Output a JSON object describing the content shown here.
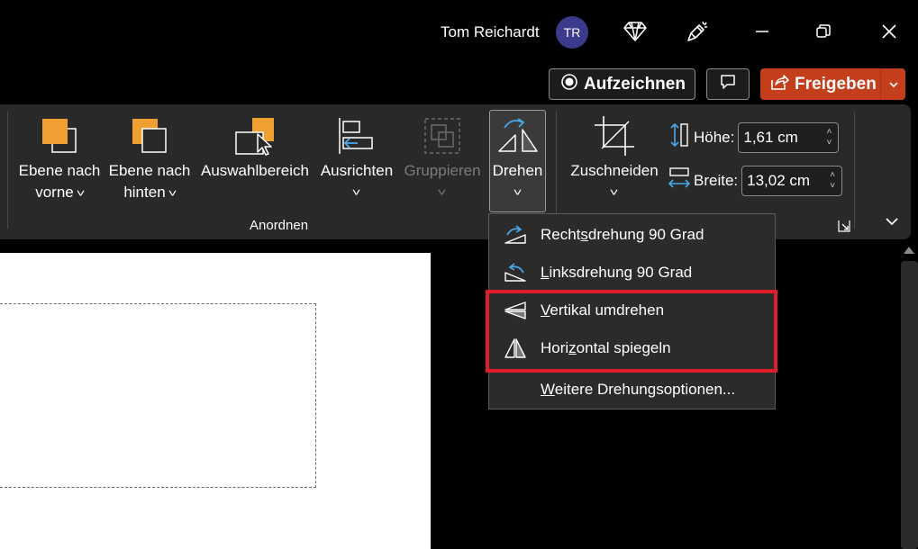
{
  "titlebar": {
    "user_name": "Tom Reichardt",
    "avatar_initials": "TR",
    "avatar_color": "#3b3a8c"
  },
  "actions": {
    "record_label": "Aufzeichnen",
    "share_label": "Freigeben",
    "share_color": "#c43e1c"
  },
  "ribbon": {
    "group_label": "Anordnen",
    "items": {
      "bring_forward": {
        "line1": "Ebene nach",
        "line2": "vorne"
      },
      "send_backward": {
        "line1": "Ebene nach",
        "line2": "hinten"
      },
      "selection_pane": {
        "label": "Auswahlbereich"
      },
      "align": {
        "label": "Ausrichten"
      },
      "group": {
        "label": "Gruppieren"
      },
      "rotate": {
        "label": "Drehen"
      },
      "crop": {
        "label": "Zuschneiden"
      }
    },
    "size": {
      "height_label": "Höhe:",
      "height_value": "1,61 cm",
      "width_label": "Breite:",
      "width_value": "13,02 cm"
    }
  },
  "menu": {
    "items": [
      {
        "pre": "Recht",
        "key": "s",
        "post": "drehung 90 Grad",
        "icon": "rotate-right-icon"
      },
      {
        "pre": "",
        "key": "L",
        "post": "inksdrehung 90 Grad",
        "icon": "rotate-left-icon"
      },
      {
        "pre": "",
        "key": "V",
        "post": "ertikal umdrehen",
        "icon": "flip-vertical-icon"
      },
      {
        "pre": "Hori",
        "key": "z",
        "post": "ontal spiegeln",
        "icon": "flip-horizontal-icon"
      },
      {
        "pre": "",
        "key": "W",
        "post": "eitere Drehungsoptionen...",
        "icon": ""
      }
    ],
    "highlight_color": "#e01e2b"
  }
}
